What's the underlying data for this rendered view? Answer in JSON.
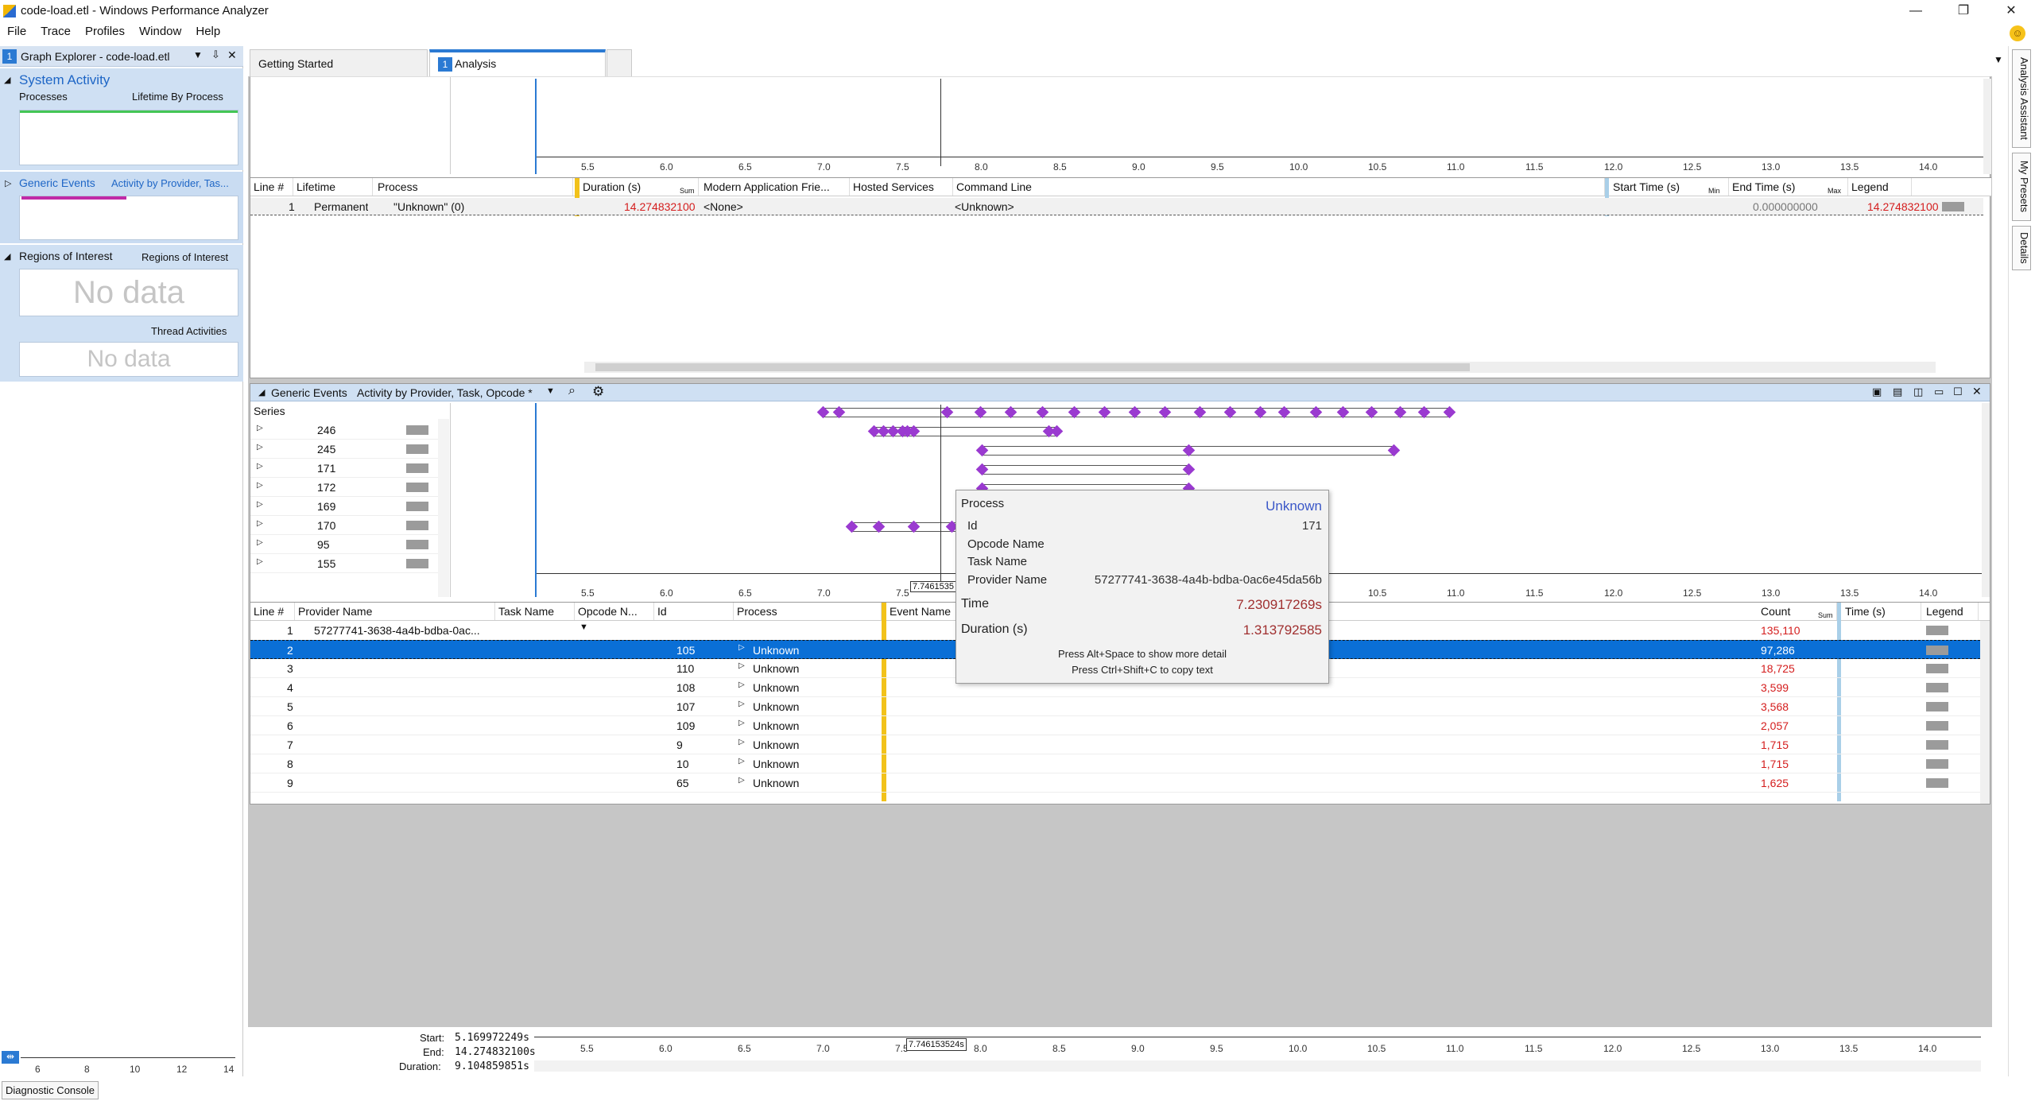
{
  "window": {
    "title": "code-load.etl - Windows Performance Analyzer"
  },
  "menu": [
    "File",
    "Trace",
    "Profiles",
    "Window",
    "Help"
  ],
  "graph_explorer": {
    "badge": "1",
    "title": "Graph Explorer - code-load.etl",
    "sections": [
      {
        "title": "System Activity",
        "left_label": "Processes",
        "right_label": "Lifetime By Process"
      },
      {
        "title": "Generic Events",
        "right_label": "Activity by Provider, Tas..."
      },
      {
        "title": "Regions of Interest",
        "right_label": "Regions of Interest",
        "nodata": "No data",
        "extra_label": "Thread Activities",
        "nodata2": "No data"
      }
    ],
    "ruler_ticks": [
      "6",
      "8",
      "10",
      "12",
      "14"
    ],
    "diagnostic": "Diagnostic Console"
  },
  "tabs": [
    {
      "label": "Getting Started"
    },
    {
      "label": "Analysis",
      "badge": "1"
    }
  ],
  "axis_ticks": [
    "5.5",
    "6.0",
    "6.5",
    "7.0",
    "7.5",
    "8.0",
    "8.5",
    "9.0",
    "9.5",
    "10.0",
    "10.5",
    "11.0",
    "11.5",
    "12.0",
    "12.5",
    "13.0",
    "13.5",
    "14.0"
  ],
  "processes_table": {
    "headers": [
      "Line #",
      "Lifetime",
      "Process",
      "Duration (s)",
      "Modern Application Frie...",
      "Hosted Services",
      "Command Line",
      "Start Time (s)",
      "End Time (s)",
      "Legend"
    ],
    "sum_label": "Sum",
    "min_label": "Min",
    "max_label": "Max",
    "row": {
      "line": "1",
      "lifetime": "Permanent",
      "process": "\"Unknown\" (0)",
      "duration": "14.274832100",
      "modern": "<None>",
      "command": "<Unknown>",
      "start": "0.000000000",
      "end": "14.274832100"
    }
  },
  "generic_events": {
    "title": "Generic Events",
    "preset": "Activity by Provider, Task, Opcode *",
    "series_label": "Series",
    "series": [
      "246",
      "245",
      "171",
      "172",
      "169",
      "170",
      "95",
      "155"
    ],
    "cursor_time": "7.7461535"
  },
  "events_table": {
    "headers": [
      "Line #",
      "Provider Name",
      "Task Name",
      "Opcode N...",
      "Id",
      "Process",
      "Event Name",
      "Count",
      "Time (s)",
      "Legend"
    ],
    "sum_label": "Sum",
    "group_row": {
      "line": "1",
      "provider": "57277741-3638-4a4b-bdba-0ac...",
      "count": "135,110"
    },
    "rows": [
      {
        "line": "2",
        "id": "105",
        "process": "Unknown",
        "count": "97,286"
      },
      {
        "line": "3",
        "id": "110",
        "process": "Unknown",
        "count": "18,725"
      },
      {
        "line": "4",
        "id": "108",
        "process": "Unknown",
        "count": "3,599"
      },
      {
        "line": "5",
        "id": "107",
        "process": "Unknown",
        "count": "3,568"
      },
      {
        "line": "6",
        "id": "109",
        "process": "Unknown",
        "count": "2,057"
      },
      {
        "line": "7",
        "id": "9",
        "process": "Unknown",
        "count": "1,715"
      },
      {
        "line": "8",
        "id": "10",
        "process": "Unknown",
        "count": "1,715"
      },
      {
        "line": "9",
        "id": "65",
        "process": "Unknown",
        "count": "1,625"
      }
    ]
  },
  "tooltip": {
    "process_label": "Process",
    "process_value": "Unknown",
    "id_label": "Id",
    "id_value": "171",
    "opcode_label": "Opcode Name",
    "task_label": "Task Name",
    "provider_label": "Provider Name",
    "provider_value": "57277741-3638-4a4b-bdba-0ac6e45da56b",
    "time_label": "Time",
    "time_value": "7.230917269s",
    "duration_label": "Duration (s)",
    "duration_value": "1.313792585",
    "hint1": "Press Alt+Space to show more detail",
    "hint2": "Press Ctrl+Shift+C to copy text"
  },
  "timeline_footer": {
    "start_label": "Start:",
    "start_value": "5.169972249s",
    "end_label": "End:",
    "end_value": "14.274832100s",
    "duration_label": "Duration:",
    "duration_value": "9.104859851s",
    "cursor": "7.746153524s"
  },
  "right_sidebar": [
    "Analysis Assistant",
    "My Presets",
    "Details"
  ]
}
